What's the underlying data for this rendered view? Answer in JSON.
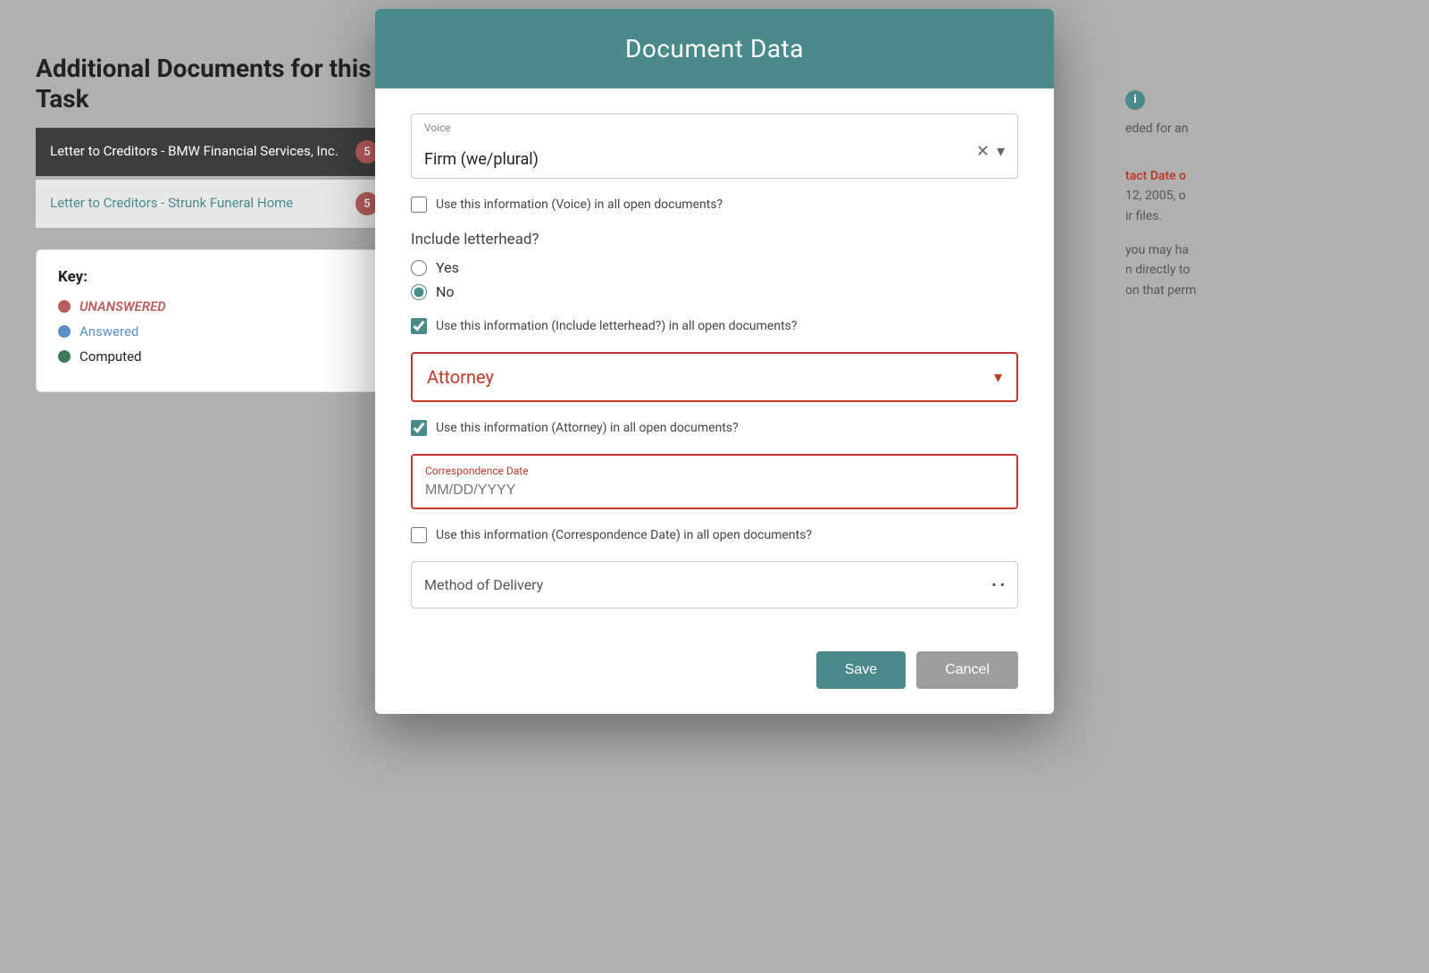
{
  "page": {
    "title": "Document Data",
    "background_color": "#b0b0b0"
  },
  "left_panel": {
    "section_title": "Additional Documents for this Task",
    "documents": [
      {
        "name": "Letter to Creditors - BMW Financial Services, Inc.",
        "badge": "5",
        "active": true
      },
      {
        "name": "Letter to Creditors - Strunk Funeral Home",
        "badge": "5",
        "active": false
      }
    ],
    "key": {
      "title": "Key:",
      "items": [
        {
          "type": "unanswered",
          "label": "UNANSWERED"
        },
        {
          "type": "answered",
          "label": "Answered"
        },
        {
          "type": "computed",
          "label": "Computed"
        }
      ]
    }
  },
  "modal": {
    "header_title": "Document Data",
    "fields": {
      "voice": {
        "label": "Voice",
        "value": "Firm (we/plural)",
        "checkbox_label": "Use this information (Voice) in all open documents?"
      },
      "letterhead": {
        "label": "Include letterhead?",
        "options": [
          "Yes",
          "No"
        ],
        "selected": "No",
        "checkbox_label": "Use this information (Include letterhead?) in all open documents?",
        "checkbox_checked": true
      },
      "attorney": {
        "label": "Attorney",
        "value": "Attorney",
        "checkbox_label": "Use this information (Attorney) in all open documents?",
        "checkbox_checked": true,
        "error": true
      },
      "correspondence_date": {
        "label": "Correspondence Date",
        "placeholder": "MM/DD/YYYY",
        "checkbox_label": "Use this information (Correspondence Date) in all open documents?",
        "checkbox_checked": false,
        "error": true
      },
      "method_of_delivery": {
        "label": "Method of Delivery",
        "value": ""
      }
    },
    "buttons": {
      "save": "Save",
      "cancel": "Cancel"
    }
  },
  "right_bg": {
    "highlight_text": "tact Date o",
    "line1": "12, 2005,  o",
    "line2": "ir files.",
    "line3": "you may ha",
    "line4": "n directly to",
    "line5": "on that perm",
    "suffix": "eded for an"
  }
}
